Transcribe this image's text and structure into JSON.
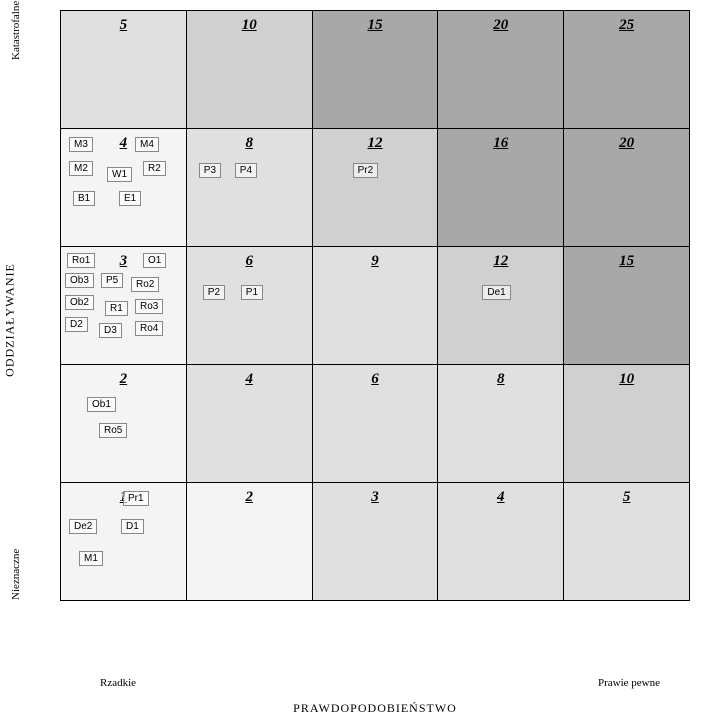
{
  "axes": {
    "y_title": "ODDZIAŁYWANIE",
    "y_high": "Katastrofalne",
    "y_low": "Nieznaczne",
    "x_title": "PRAWDOPODOBIEŃSTWO",
    "x_low": "Rzadkie",
    "x_high": "Prawie pewne"
  },
  "colors": {
    "shade1": "#f4f4f4",
    "shade2": "#e0e0e0",
    "shade3": "#d0d0d0",
    "shade4": "#a8a8a8"
  },
  "chart_data": {
    "type": "heatmap",
    "title": "",
    "x_categories": [
      "Rzadkie",
      "",
      "",
      "",
      "Prawie pewne"
    ],
    "y_categories": [
      "Katastrofalne",
      "",
      "",
      "",
      "Nieznaczne"
    ],
    "scores": [
      [
        5,
        10,
        15,
        20,
        25
      ],
      [
        4,
        8,
        12,
        16,
        20
      ],
      [
        3,
        6,
        9,
        12,
        15
      ],
      [
        2,
        4,
        6,
        8,
        10
      ],
      [
        1,
        2,
        3,
        4,
        5
      ]
    ],
    "shade_level": [
      [
        2,
        3,
        4,
        4,
        4
      ],
      [
        1,
        2,
        3,
        4,
        4
      ],
      [
        1,
        2,
        2,
        3,
        4
      ],
      [
        1,
        2,
        2,
        2,
        3
      ],
      [
        1,
        1,
        2,
        2,
        2
      ]
    ],
    "items": {
      "r1c0": [
        "M3",
        "M4",
        "M2",
        "W1",
        "R2",
        "B1",
        "E1"
      ],
      "r1c1": [
        "P3",
        "P4"
      ],
      "r1c2": [
        "Pr2"
      ],
      "r2c0": [
        "Ro1",
        "O1",
        "Ob3",
        "P5",
        "Ro2",
        "Ob2",
        "R1",
        "Ro3",
        "D2",
        "D3",
        "Ro4"
      ],
      "r2c1": [
        "P2",
        "P1"
      ],
      "r2c3": [
        "De1"
      ],
      "r3c0": [
        "Ob1",
        "Ro5"
      ],
      "r4c0": [
        "Pr1",
        "De2",
        "D1",
        "M1"
      ]
    }
  },
  "cells": {
    "r0c0": {
      "score": "5"
    },
    "r0c1": {
      "score": "10"
    },
    "r0c2": {
      "score": "15"
    },
    "r0c3": {
      "score": "20"
    },
    "r0c4": {
      "score": "25"
    },
    "r1c0": {
      "score": "4",
      "t0": "M3",
      "t1": "M4",
      "t2": "M2",
      "t3": "W1",
      "t4": "R2",
      "t5": "B1",
      "t6": "E1"
    },
    "r1c1": {
      "score": "8",
      "t0": "P3",
      "t1": "P4"
    },
    "r1c2": {
      "score": "12",
      "t0": "Pr2"
    },
    "r1c3": {
      "score": "16"
    },
    "r1c4": {
      "score": "20"
    },
    "r2c0": {
      "score": "3",
      "t0": "Ro1",
      "t1": "O1",
      "t2": "Ob3",
      "t3": "P5",
      "t4": "Ro2",
      "t5": "Ob2",
      "t6": "R1",
      "t7": "Ro3",
      "t8": "D2",
      "t9": "D3",
      "t10": "Ro4"
    },
    "r2c1": {
      "score": "6",
      "t0": "P2",
      "t1": "P1"
    },
    "r2c2": {
      "score": "9"
    },
    "r2c3": {
      "score": "12",
      "t0": "De1"
    },
    "r2c4": {
      "score": "15"
    },
    "r3c0": {
      "score": "2",
      "t0": "Ob1",
      "t1": "Ro5"
    },
    "r3c1": {
      "score": "4"
    },
    "r3c2": {
      "score": "6"
    },
    "r3c3": {
      "score": "8"
    },
    "r3c4": {
      "score": "10"
    },
    "r4c0": {
      "score": "1",
      "t0": "Pr1",
      "t1": "De2",
      "t2": "D1",
      "t3": "M1"
    },
    "r4c1": {
      "score": "2"
    },
    "r4c2": {
      "score": "3"
    },
    "r4c3": {
      "score": "4"
    },
    "r4c4": {
      "score": "5"
    }
  }
}
